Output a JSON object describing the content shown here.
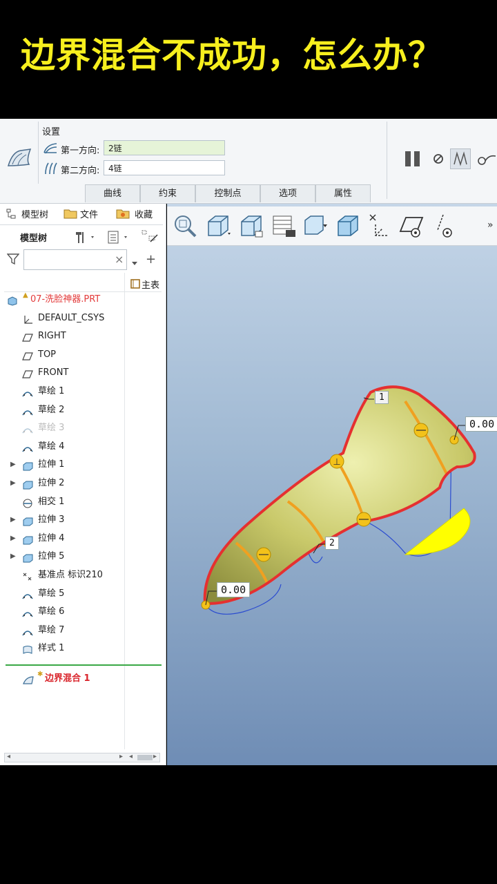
{
  "banner": {
    "title": "边界混合不成功，怎么办？"
  },
  "ribbon": {
    "settings_label": "设置",
    "first_dir_label": "第一方向:",
    "first_dir_value": "2链",
    "second_dir_label": "第二方向:",
    "second_dir_value": "4链",
    "tabs": [
      "曲线",
      "约束",
      "控制点",
      "选项",
      "属性"
    ]
  },
  "panel": {
    "tabs": [
      "模型树",
      "文件",
      "收藏"
    ],
    "tree_heading": "模型树",
    "filter_placeholder": "",
    "clear_icon": "×",
    "main_table": "主表",
    "items": [
      {
        "label": "07-洗脸神器.PRT",
        "icon": "part-icon",
        "color": "#e33a3a"
      },
      {
        "label": "DEFAULT_CSYS",
        "icon": "csys-icon"
      },
      {
        "label": "RIGHT",
        "icon": "plane-icon"
      },
      {
        "label": "TOP",
        "icon": "plane-icon"
      },
      {
        "label": "FRONT",
        "icon": "plane-icon"
      },
      {
        "label": "草绘 1",
        "icon": "sketch-icon"
      },
      {
        "label": "草绘 2",
        "icon": "sketch-icon"
      },
      {
        "label": "草绘 3",
        "icon": "sketch-icon",
        "dimmed": true
      },
      {
        "label": "草绘 4",
        "icon": "sketch-icon"
      },
      {
        "label": "拉伸 1",
        "icon": "extrude-icon",
        "expandable": true
      },
      {
        "label": "拉伸 2",
        "icon": "extrude-icon",
        "expandable": true
      },
      {
        "label": "相交 1",
        "icon": "intersect-icon"
      },
      {
        "label": "拉伸 3",
        "icon": "extrude-icon",
        "expandable": true
      },
      {
        "label": "拉伸 4",
        "icon": "extrude-icon",
        "expandable": true
      },
      {
        "label": "拉伸 5",
        "icon": "extrude-icon",
        "expandable": true
      },
      {
        "label": "基准点 标识210",
        "icon": "datum-point-icon"
      },
      {
        "label": "草绘 5",
        "icon": "sketch-icon"
      },
      {
        "label": "草绘 6",
        "icon": "sketch-icon"
      },
      {
        "label": "草绘 7",
        "icon": "sketch-icon"
      },
      {
        "label": "样式 1",
        "icon": "style-icon"
      }
    ],
    "active_feature": "边界混合 1"
  },
  "viewport": {
    "dim_top_right": "0.00",
    "dim_bottom_left": "0.00",
    "dim_top": "1",
    "dim_mid": "2",
    "surface_color": "#c8c86a",
    "boundary_color": "#e53030",
    "section_color": "#f0a020",
    "patch_color": "#ffff00"
  }
}
